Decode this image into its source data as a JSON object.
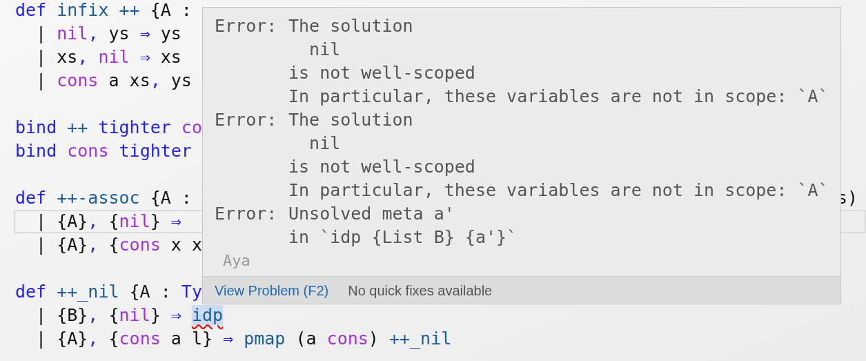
{
  "editor": {
    "lines": [
      {
        "kind": "code",
        "current": false,
        "tokens": [
          {
            "text": "def",
            "kind": "keyword"
          },
          {
            "text": " infix ++",
            "kind": "fn"
          },
          {
            "text": " {A :",
            "kind": "plain"
          }
        ]
      },
      {
        "kind": "code",
        "current": false,
        "tokens": [
          {
            "text": "  | ",
            "kind": "plain"
          },
          {
            "text": "nil",
            "kind": "ctor"
          },
          {
            "text": ",",
            "kind": "punct"
          },
          {
            "text": " ys ",
            "kind": "plain"
          },
          {
            "text": "⇒",
            "kind": "keyword"
          },
          {
            "text": " ys",
            "kind": "plain"
          }
        ]
      },
      {
        "kind": "code",
        "current": false,
        "tokens": [
          {
            "text": "  | xs",
            "kind": "plain"
          },
          {
            "text": ",",
            "kind": "punct"
          },
          {
            "text": " nil",
            "kind": "ctor"
          },
          {
            "text": " ⇒",
            "kind": "keyword"
          },
          {
            "text": " xs",
            "kind": "plain"
          }
        ]
      },
      {
        "kind": "code",
        "current": false,
        "tokens": [
          {
            "text": "  | ",
            "kind": "plain"
          },
          {
            "text": "cons",
            "kind": "ctor"
          },
          {
            "text": " a xs",
            "kind": "plain"
          },
          {
            "text": ",",
            "kind": "punct"
          },
          {
            "text": " ys",
            "kind": "plain"
          }
        ]
      },
      {
        "kind": "blank",
        "current": false
      },
      {
        "kind": "code",
        "current": false,
        "tokens": [
          {
            "text": "bind",
            "kind": "keyword"
          },
          {
            "text": " ++",
            "kind": "fn"
          },
          {
            "text": " tighter",
            "kind": "keyword"
          },
          {
            "text": " co",
            "kind": "ctor"
          }
        ]
      },
      {
        "kind": "code",
        "current": false,
        "tokens": [
          {
            "text": "bind",
            "kind": "keyword"
          },
          {
            "text": " cons",
            "kind": "ctor"
          },
          {
            "text": " tighter",
            "kind": "keyword"
          }
        ]
      },
      {
        "kind": "blank",
        "current": false
      },
      {
        "kind": "code",
        "current": false,
        "tokens": [
          {
            "text": "def",
            "kind": "keyword"
          },
          {
            "text": " ++-assoc",
            "kind": "fn"
          },
          {
            "text": " {A :",
            "kind": "plain"
          }
        ],
        "right": "s)"
      },
      {
        "kind": "code",
        "current": true,
        "tokens": [
          {
            "text": "  | {A}",
            "kind": "plain"
          },
          {
            "text": ",",
            "kind": "punct"
          },
          {
            "text": " {",
            "kind": "plain"
          },
          {
            "text": "nil",
            "kind": "ctor"
          },
          {
            "text": "} ",
            "kind": "plain"
          },
          {
            "text": "⇒",
            "kind": "keyword"
          }
        ]
      },
      {
        "kind": "code",
        "current": false,
        "tokens": [
          {
            "text": "  | {A}",
            "kind": "plain"
          },
          {
            "text": ",",
            "kind": "punct"
          },
          {
            "text": " {",
            "kind": "plain"
          },
          {
            "text": "cons",
            "kind": "ctor"
          },
          {
            "text": " x x",
            "kind": "plain"
          }
        ]
      },
      {
        "kind": "blank",
        "current": false
      },
      {
        "kind": "code",
        "current": false,
        "tokens": [
          {
            "text": "def",
            "kind": "keyword"
          },
          {
            "text": " ++_nil",
            "kind": "fn"
          },
          {
            "text": " {A : ",
            "kind": "plain"
          },
          {
            "text": "Ty",
            "kind": "keyword"
          }
        ]
      },
      {
        "kind": "code",
        "current": false,
        "tokens": [
          {
            "text": "  | {B}",
            "kind": "plain"
          },
          {
            "text": ",",
            "kind": "punct"
          },
          {
            "text": " {",
            "kind": "plain"
          },
          {
            "text": "nil",
            "kind": "ctor"
          },
          {
            "text": "} ",
            "kind": "plain"
          },
          {
            "text": "⇒ ",
            "kind": "keyword"
          },
          {
            "text": "idp",
            "kind": "error"
          }
        ]
      },
      {
        "kind": "code",
        "current": false,
        "tokens": [
          {
            "text": "  | {A}",
            "kind": "plain"
          },
          {
            "text": ",",
            "kind": "punct"
          },
          {
            "text": " {",
            "kind": "plain"
          },
          {
            "text": "cons",
            "kind": "ctor"
          },
          {
            "text": " a l} ",
            "kind": "plain"
          },
          {
            "text": "⇒",
            "kind": "keyword"
          },
          {
            "text": " pmap",
            "kind": "fn"
          },
          {
            "text": " (a ",
            "kind": "plain"
          },
          {
            "text": "cons",
            "kind": "ctor"
          },
          {
            "text": ") ",
            "kind": "plain"
          },
          {
            "text": "++_nil",
            "kind": "fn"
          }
        ]
      }
    ]
  },
  "hover": {
    "messages": [
      {
        "label": "Error:",
        "lines": [
          "The solution",
          "  nil",
          "is not well-scoped",
          "In particular, these variables are not in scope: `A`"
        ]
      },
      {
        "label": "Error:",
        "lines": [
          "The solution",
          "  nil",
          "is not well-scoped",
          "In particular, these variables are not in scope: `A`"
        ]
      },
      {
        "label": "Error:",
        "lines": [
          "Unsolved meta a'",
          "in `idp {List B} {a'}`"
        ]
      }
    ],
    "source": "Aya",
    "action": "View Problem (F2)",
    "status": "No quick fixes available"
  }
}
